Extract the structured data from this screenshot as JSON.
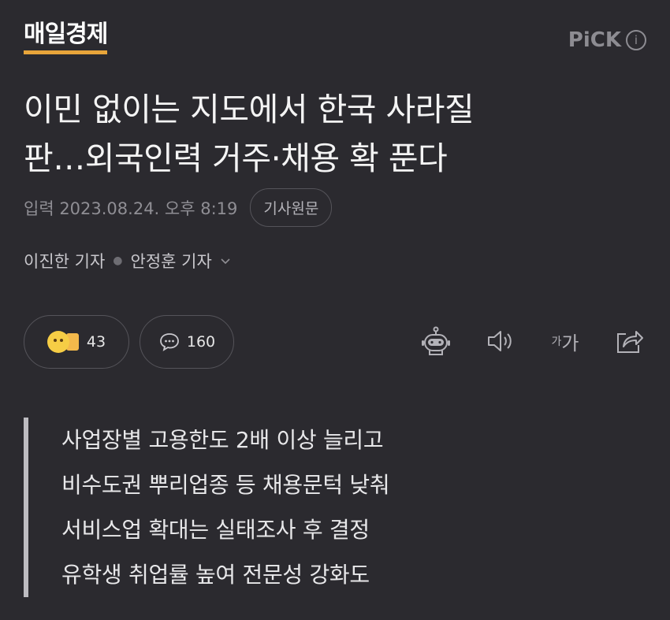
{
  "header": {
    "press_name": "매일경제",
    "pick_label": "PiCK",
    "info_icon": "info-icon"
  },
  "article": {
    "title_line1": "이민 없이는 지도에서 한국 사라질",
    "title_line2": "판…외국인력 거주·채용 확 푼다",
    "timestamp": "입력 2023.08.24. 오후 8:19",
    "original_button": "기사원문",
    "reporter1": "이진한 기자",
    "reporter2": "안정훈 기자"
  },
  "reactions": {
    "react_count": "43",
    "comment_count": "160"
  },
  "tools": {
    "font_small": "가",
    "font_large": "가",
    "icons": [
      "robot-icon",
      "speaker-icon",
      "font-size-icon",
      "share-icon"
    ]
  },
  "summary": [
    "사업장별 고용한도 2배 이상 늘리고",
    "비수도권 뿌리업종 등 채용문턱 낮춰",
    "서비스업 확대는 실태조사 후 결정",
    "유학생 취업률 높여 전문성 강화도"
  ],
  "colors": {
    "background": "#2b2a2f",
    "logo_underline": "#e8a53a"
  }
}
